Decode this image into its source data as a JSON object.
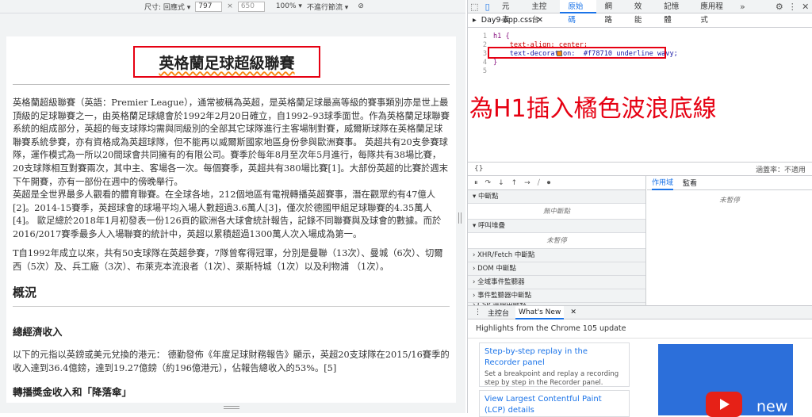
{
  "viewport": {
    "size_label": "尺寸: 回應式 ▾",
    "width": "797",
    "height": "650",
    "zoom": "100% ▾",
    "throttle": "不進行節流 ▾"
  },
  "page": {
    "h1": "英格蘭足球超級聯賽",
    "p1": "英格蘭超級聯賽（英語：Premier League），通常被稱為英超，是英格蘭足球最高等級的賽事類別亦是世上最頂級的足球聯賽之一，由英格蘭足球總會於1992年2月20日確立，自1992–93球季面世。作為英格蘭足球聯賽系統的組成部分，英超的每支球隊均需與同級別的全部其它球隊進行主客場制對賽，威爾斯球隊在英格蘭足球聯賽系統參賽，亦有資格成為英超球隊，但不能再以威爾斯國家地區身份參與歐洲賽事。 英超共有20支參賽球隊，運作模式為一所以20間球會共同擁有的有限公司。賽季於每年8月至次年5月進行，每隊共有38場比賽，20支球隊相互對賽兩次，其中主、客場各一次。每個賽季，英超共有380場比賽[1]。大部份英超的比賽於週末下午開賽，亦有一部份在週中的傍晚舉行。",
    "p2": "英超是全世界最多人觀看的體育聯賽。在全球各地，212個地區有電視轉播英超賽事，潛在觀眾約有47億人[2]。2014-15賽季，英超球會的球場平均入場人數超過3.6萬人[3]，僅次於德國甲組足球聯賽的4.35萬人[4]。 歐足總於2018年1月初發表一份126頁的歐洲各大球會統計報告，記錄不同聯賽與及球會的數據。而於2016/2017賽季最多人入場聯賽的統計中，英超以累積超過1300萬人次入場成為第一。",
    "p3": "T自1992年成立以來，共有50支球隊在英超參賽，7隊曾奪得冠軍，分別是曼聯（13次）、曼城（6次）、切爾西（5次）及、兵工廠（3次）、布萊克本流浪者（1次）、萊斯特城（1次）以及利物浦 （1次）。",
    "h2": "概況",
    "h3a": "總經濟收入",
    "p4": "以下的元指以英鎊或美元兌換的港元： 德勤發佈《年度足球財務報告》顯示，英超20支球隊在2015/16賽季的收入達到36.4億鎊，達到19.27億鎊（約196億港元），佔報告總收入的53%。[5]",
    "h3b": "轉播獎金收入和「降落傘」"
  },
  "devtools": {
    "tabs": [
      "元素",
      "主控台",
      "原始碼",
      "網路",
      "效能",
      "記憶體",
      "應用程式"
    ],
    "active_tab": "原始碼",
    "file": "Day9-app.css",
    "code_lines": [
      "h1 {",
      "    text-align: center;",
      "    text-decoration:  #f78710 underline wavy;",
      "}"
    ],
    "line_numbers": [
      "1",
      "2",
      "3",
      "4",
      "5"
    ],
    "coverage": "涵蓋率：不適用",
    "pretty": "{}",
    "sections": [
      "▾ 中斷點",
      "▾ 呼叫堆疊",
      "› XHR/Fetch 中斷點",
      "› DOM 中斷點",
      "› 全域事件監聽器",
      "› 事件監聽器中斷點",
      "› CSP 違規中斷點"
    ],
    "no_breakpoints": "無中斷點",
    "not_paused": "未暫停",
    "scope_tabs": [
      "作用域",
      "監看"
    ],
    "scope_not_paused": "未暫停",
    "drawer_tabs": [
      "主控台",
      "What's New"
    ],
    "highlights": "Highlights from the Chrome 105 update",
    "card1_title": "Step-by-step replay in the Recorder panel",
    "card1_desc": "Set a breakpoint and replay a recording step by step in the Recorder panel.",
    "card2_title": "View Largest Contentful Paint (LCP) details",
    "video_label": "new"
  },
  "annotation": "為H1插入橘色波浪底線",
  "colors": {
    "accent": "#1a73e8",
    "annotation": "#e60012",
    "wavy": "#f78710"
  }
}
